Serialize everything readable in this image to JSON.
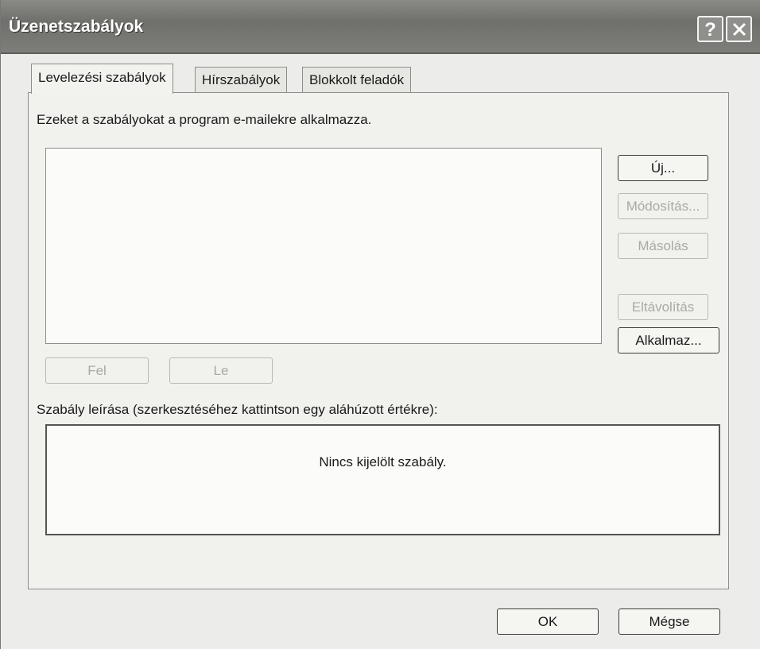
{
  "window": {
    "title": "Üzenetszabályok",
    "help_label": "?",
    "close_icon": "close-icon"
  },
  "tabs": [
    {
      "label": "Levelezési szabályok",
      "active": true
    },
    {
      "label": "Hírszabályok",
      "active": false
    },
    {
      "label": "Blokkolt feladók",
      "active": false
    }
  ],
  "panel": {
    "intro": "Ezeket a szabályokat a program e-mailekre alkalmazza.",
    "rules": [],
    "buttons": {
      "new": "Új...",
      "modify": "Módosítás...",
      "copy": "Másolás",
      "remove": "Eltávolítás",
      "apply": "Alkalmaz..."
    },
    "move_up": "Fel",
    "move_down": "Le",
    "description_label": "Szabály leírása (szerkesztéséhez kattintson egy aláhúzott értékre):",
    "description_text": "Nincs kijelölt szabály."
  },
  "footer": {
    "ok": "OK",
    "cancel": "Mégse"
  }
}
